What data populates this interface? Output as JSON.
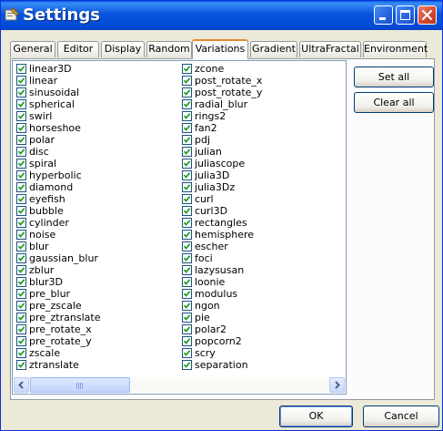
{
  "window": {
    "title": "Settings",
    "title_bar_color": "#0856dd",
    "buttons": {
      "minimize": "minimize-icon",
      "maximize": "maximize-icon",
      "close": "close-icon"
    }
  },
  "tabs": [
    {
      "label": "General",
      "active": false
    },
    {
      "label": "Editor",
      "active": false
    },
    {
      "label": "Display",
      "active": false
    },
    {
      "label": "Random",
      "active": false
    },
    {
      "label": "Variations",
      "active": true
    },
    {
      "label": "Gradient",
      "active": false
    },
    {
      "label": "UltraFractal",
      "active": false
    },
    {
      "label": "Environment",
      "active": false
    }
  ],
  "variations": {
    "left_column": [
      {
        "label": "linear3D",
        "checked": true
      },
      {
        "label": "linear",
        "checked": true
      },
      {
        "label": "sinusoidal",
        "checked": true
      },
      {
        "label": "spherical",
        "checked": true
      },
      {
        "label": "swirl",
        "checked": true
      },
      {
        "label": "horseshoe",
        "checked": true
      },
      {
        "label": "polar",
        "checked": true
      },
      {
        "label": "disc",
        "checked": true
      },
      {
        "label": "spiral",
        "checked": true
      },
      {
        "label": "hyperbolic",
        "checked": true
      },
      {
        "label": "diamond",
        "checked": true
      },
      {
        "label": "eyefish",
        "checked": true
      },
      {
        "label": "bubble",
        "checked": true
      },
      {
        "label": "cylinder",
        "checked": true
      },
      {
        "label": "noise",
        "checked": true
      },
      {
        "label": "blur",
        "checked": true
      },
      {
        "label": "gaussian_blur",
        "checked": true
      },
      {
        "label": "zblur",
        "checked": true
      },
      {
        "label": "blur3D",
        "checked": true
      },
      {
        "label": "pre_blur",
        "checked": true
      },
      {
        "label": "pre_zscale",
        "checked": true
      },
      {
        "label": "pre_ztranslate",
        "checked": true
      },
      {
        "label": "pre_rotate_x",
        "checked": true
      },
      {
        "label": "pre_rotate_y",
        "checked": true
      },
      {
        "label": "zscale",
        "checked": true
      },
      {
        "label": "ztranslate",
        "checked": true
      }
    ],
    "right_column": [
      {
        "label": "zcone",
        "checked": true
      },
      {
        "label": "post_rotate_x",
        "checked": true
      },
      {
        "label": "post_rotate_y",
        "checked": true
      },
      {
        "label": "radial_blur",
        "checked": true
      },
      {
        "label": "rings2",
        "checked": true
      },
      {
        "label": "fan2",
        "checked": true
      },
      {
        "label": "pdj",
        "checked": true
      },
      {
        "label": "julian",
        "checked": true
      },
      {
        "label": "juliascope",
        "checked": true
      },
      {
        "label": "julia3D",
        "checked": true
      },
      {
        "label": "julia3Dz",
        "checked": true
      },
      {
        "label": "curl",
        "checked": true
      },
      {
        "label": "curl3D",
        "checked": true
      },
      {
        "label": "rectangles",
        "checked": true
      },
      {
        "label": "hemisphere",
        "checked": true
      },
      {
        "label": "escher",
        "checked": true
      },
      {
        "label": "foci",
        "checked": true
      },
      {
        "label": "lazysusan",
        "checked": true
      },
      {
        "label": "loonie",
        "checked": true
      },
      {
        "label": "modulus",
        "checked": true
      },
      {
        "label": "ngon",
        "checked": true
      },
      {
        "label": "pie",
        "checked": true
      },
      {
        "label": "polar2",
        "checked": true
      },
      {
        "label": "popcorn2",
        "checked": true
      },
      {
        "label": "scry",
        "checked": true
      },
      {
        "label": "separation",
        "checked": true
      }
    ]
  },
  "side_buttons": {
    "set_all": "Set all",
    "clear_all": "Clear all"
  },
  "footer": {
    "ok": "OK",
    "cancel": "Cancel"
  },
  "colors": {
    "checkmark": "#21a121",
    "tab_highlight": "#e68b2c",
    "dialog_bg": "#ece9d8"
  }
}
